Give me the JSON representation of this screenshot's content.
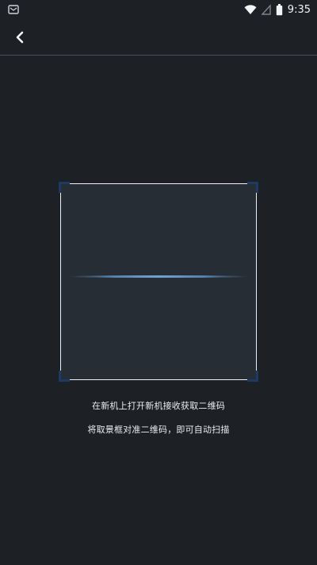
{
  "status_bar": {
    "time": "9:35",
    "icons": [
      "notification-icon",
      "wifi-icon",
      "signal-icon",
      "battery-icon"
    ]
  },
  "app_bar": {
    "back_icon": "chevron-left-icon"
  },
  "scanner": {
    "frame_color": "#eef2f6",
    "corner_color": "#1c3a62",
    "scan_line_color": "#6ea0d2"
  },
  "hints": {
    "line1": "在新机上打开新机接收获取二维码",
    "line2": "将取景框对准二维码，即可自动扫描"
  }
}
